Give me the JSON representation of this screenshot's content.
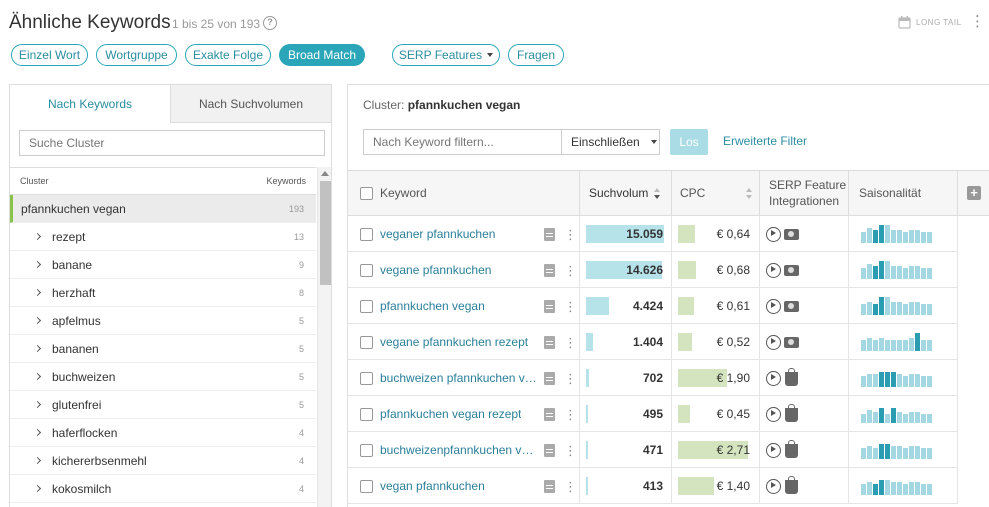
{
  "header": {
    "title": "Ähnliche Keywords",
    "meta": "1 bis 25 von 193",
    "long_tail": "LONG TAIL"
  },
  "chips": [
    {
      "label": "Einzel Wort"
    },
    {
      "label": "Wortgruppe"
    },
    {
      "label": "Exakte Folge"
    },
    {
      "label": "Broad Match"
    },
    {
      "label": "SERP Features"
    },
    {
      "label": "Fragen"
    }
  ],
  "left": {
    "tabs": [
      "Nach Keywords",
      "Nach Suchvolumen"
    ],
    "search_placeholder": "Suche Cluster",
    "col_cluster": "Cluster",
    "col_keywords": "Keywords",
    "items": [
      {
        "label": "pfannkuchen vegan",
        "count": "193"
      },
      {
        "label": "rezept",
        "count": "13"
      },
      {
        "label": "banane",
        "count": "9"
      },
      {
        "label": "herzhaft",
        "count": "8"
      },
      {
        "label": "apfelmus",
        "count": "5"
      },
      {
        "label": "bananen",
        "count": "5"
      },
      {
        "label": "buchweizen",
        "count": "5"
      },
      {
        "label": "glutenfrei",
        "count": "5"
      },
      {
        "label": "haferflocken",
        "count": "4"
      },
      {
        "label": "kichererbsenmehl",
        "count": "4"
      },
      {
        "label": "kokosmilch",
        "count": "4"
      }
    ]
  },
  "right": {
    "cluster_label": "Cluster:",
    "cluster_value": "pfannkuchen vegan",
    "filter_placeholder": "Nach Keyword filtern...",
    "include_label": "Einschließen",
    "go_label": "Los",
    "advanced_filter": "Erweiterte Filter",
    "columns": {
      "keyword": "Keyword",
      "volume": "Suchvolum",
      "cpc": "CPC",
      "serp1": "SERP Feature",
      "serp2": "Integrationen",
      "season": "Saisonalität"
    },
    "rows": [
      {
        "keyword": "veganer pfannkuchen",
        "volume": "15.059",
        "vol_frac": 1.0,
        "cpc": "€ 0,64",
        "cpc_frac": 0.24,
        "serp": "video",
        "season": [
          5,
          7,
          6,
          8,
          8,
          6,
          6,
          5,
          6,
          6,
          5,
          5
        ],
        "season_hi": [
          2,
          3
        ]
      },
      {
        "keyword": "vegane pfannkuchen",
        "volume": "14.626",
        "vol_frac": 0.97,
        "cpc": "€ 0,68",
        "cpc_frac": 0.25,
        "serp": "video",
        "season": [
          5,
          7,
          6,
          8,
          8,
          6,
          6,
          5,
          6,
          6,
          5,
          5
        ],
        "season_hi": [
          2,
          3
        ]
      },
      {
        "keyword": "pfannkuchen vegan",
        "volume": "4.424",
        "vol_frac": 0.29,
        "cpc": "€ 0,61",
        "cpc_frac": 0.23,
        "serp": "video",
        "season": [
          5,
          6,
          5,
          8,
          8,
          6,
          6,
          5,
          6,
          6,
          5,
          5
        ],
        "season_hi": [
          2,
          3
        ]
      },
      {
        "keyword": "vegane pfannkuchen rezept",
        "volume": "1.404",
        "vol_frac": 0.09,
        "cpc": "€ 0,52",
        "cpc_frac": 0.2,
        "serp": "video",
        "season": [
          5,
          6,
          5,
          6,
          5,
          5,
          5,
          5,
          6,
          8,
          5,
          5
        ],
        "season_hi": [
          9
        ]
      },
      {
        "keyword": "buchweizen pfannkuchen ve...",
        "volume": "702",
        "vol_frac": 0.04,
        "cpc": "€ 1,90",
        "cpc_frac": 0.7,
        "serp": "shop",
        "season": [
          5,
          6,
          6,
          7,
          7,
          7,
          6,
          5,
          6,
          6,
          5,
          5
        ],
        "season_hi": [
          3,
          4,
          5
        ]
      },
      {
        "keyword": "pfannkuchen vegan rezept",
        "volume": "495",
        "vol_frac": 0.03,
        "cpc": "€ 0,45",
        "cpc_frac": 0.17,
        "serp": "shop",
        "season": [
          4,
          6,
          5,
          7,
          4,
          7,
          5,
          4,
          5,
          5,
          4,
          4
        ],
        "season_hi": [
          3,
          5
        ]
      },
      {
        "keyword": "buchweizenpfannkuchen veg...",
        "volume": "471",
        "vol_frac": 0.03,
        "cpc": "€ 2,71",
        "cpc_frac": 1.0,
        "serp": "shop",
        "season": [
          5,
          6,
          5,
          7,
          7,
          6,
          6,
          5,
          6,
          6,
          5,
          5
        ],
        "season_hi": [
          3,
          4
        ]
      },
      {
        "keyword": "vegan pfannkuchen",
        "volume": "413",
        "vol_frac": 0.03,
        "cpc": "€ 1,40",
        "cpc_frac": 0.52,
        "serp": "shop",
        "season": [
          5,
          6,
          5,
          7,
          7,
          6,
          6,
          5,
          6,
          6,
          5,
          5
        ],
        "season_hi": [
          2,
          3
        ]
      }
    ]
  }
}
